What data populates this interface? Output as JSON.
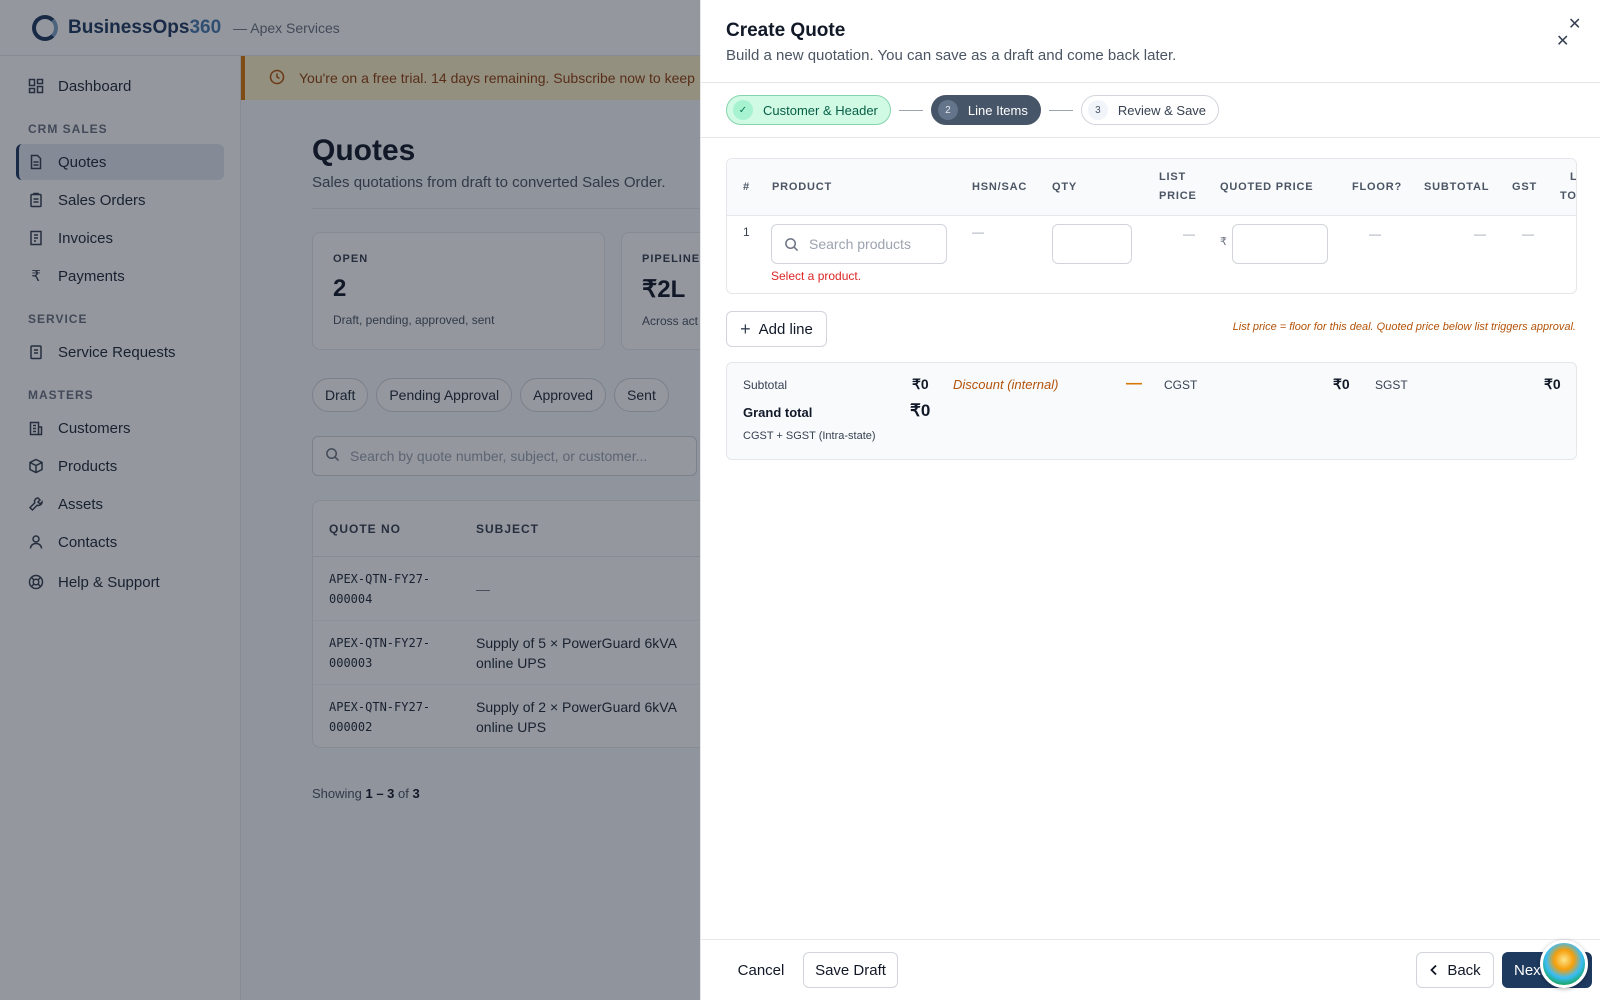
{
  "app": {
    "brand_main": "BusinessOps",
    "brand_accent": "360",
    "org": "— Apex Services"
  },
  "sidebar": {
    "top": [
      {
        "label": "Dashboard",
        "icon": "dashboard-icon"
      }
    ],
    "sections": [
      {
        "title": "CRM SALES",
        "items": [
          {
            "label": "Quotes",
            "icon": "document-icon",
            "active": true
          },
          {
            "label": "Sales Orders",
            "icon": "clipboard-icon"
          },
          {
            "label": "Invoices",
            "icon": "invoice-icon"
          },
          {
            "label": "Payments",
            "icon": "rupee-icon"
          }
        ]
      },
      {
        "title": "SERVICE",
        "items": [
          {
            "label": "Service Requests",
            "icon": "ticket-icon"
          }
        ]
      },
      {
        "title": "MASTERS",
        "items": [
          {
            "label": "Customers",
            "icon": "building-icon"
          },
          {
            "label": "Products",
            "icon": "box-icon"
          },
          {
            "label": "Assets",
            "icon": "wrench-icon"
          },
          {
            "label": "Contacts",
            "icon": "user-icon"
          }
        ]
      }
    ],
    "help": {
      "label": "Help & Support",
      "icon": "lifebuoy-icon"
    }
  },
  "trial_banner": "You're on a free trial. 14 days remaining. Subscribe now to keep",
  "page": {
    "title": "Quotes",
    "subtitle": "Sales quotations from draft to converted Sales Order."
  },
  "stats": [
    {
      "label": "OPEN",
      "value": "2",
      "desc": "Draft, pending, approved, sent"
    },
    {
      "label": "PIPELINE",
      "value": "₹2L",
      "desc": "Across act"
    }
  ],
  "filters": [
    "Draft",
    "Pending Approval",
    "Approved",
    "Sent"
  ],
  "search_placeholder": "Search by quote number, subject, or customer...",
  "quotes_table": {
    "headers": [
      "QUOTE NO",
      "SUBJECT"
    ],
    "rows": [
      {
        "no1": "APEX-QTN-FY27-",
        "no2": "000004",
        "subject1": "—",
        "subject2": ""
      },
      {
        "no1": "APEX-QTN-FY27-",
        "no2": "000003",
        "subject1": "Supply of 5 × PowerGuard 6kVA",
        "subject2": "online UPS"
      },
      {
        "no1": "APEX-QTN-FY27-",
        "no2": "000002",
        "subject1": "Supply of 2 × PowerGuard 6kVA",
        "subject2": "online UPS"
      }
    ]
  },
  "showing": {
    "prefix": "Showing ",
    "range": "1 – 3",
    "of": " of ",
    "total": "3"
  },
  "panel": {
    "title": "Create Quote",
    "subtitle": "Build a new quotation. You can save as a draft and come back later.",
    "steps": [
      {
        "num": "✓",
        "label": "Customer & Header",
        "state": "done"
      },
      {
        "num": "2",
        "label": "Line Items",
        "state": "current"
      },
      {
        "num": "3",
        "label": "Review & Save",
        "state": "todo"
      }
    ],
    "line_headers": {
      "num": "#",
      "product": "PRODUCT",
      "hsn": "HSN/SAC",
      "qty": "QTY",
      "list1": "LIST",
      "list2": "PRICE",
      "quoted": "QUOTED PRICE",
      "floor": "FLOOR?",
      "subtotal": "SUBTOTAL",
      "gst": "GST",
      "lt1": "L",
      "lt2": "TO"
    },
    "line_row": {
      "num": "1",
      "product_placeholder": "Search products",
      "hsn": "—",
      "list_price": "—",
      "currency": "₹",
      "floor": "—",
      "subtotal": "—",
      "gst": "—",
      "error": "Select a product."
    },
    "add_line": "Add line",
    "note": "List price = floor for this deal. Quoted price below list triggers approval.",
    "summary": {
      "subtotal_label": "Subtotal",
      "subtotal": "₹0",
      "grand_label": "Grand total",
      "grand": "₹0",
      "tax_mode": "CGST + SGST (Intra-state)",
      "discount_label": "Discount (internal)",
      "discount": "—",
      "cgst_label": "CGST",
      "cgst": "₹0",
      "sgst_label": "SGST",
      "sgst": "₹0"
    },
    "buttons": {
      "cancel": "Cancel",
      "save_draft": "Save Draft",
      "back": "Back",
      "next": "Next"
    }
  },
  "colors": {
    "brand": "#1e3a5f",
    "warning": "#b45309",
    "error": "#dc2626",
    "success": "#065f46"
  }
}
